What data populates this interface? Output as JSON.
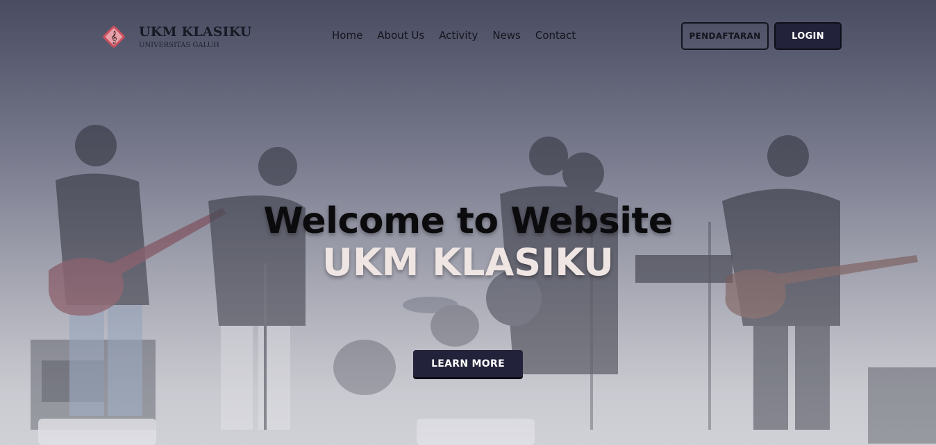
{
  "brand": {
    "title": "UKM KLASIKU",
    "subtitle": "UNIVERSITAS GALUH",
    "logo_icon": "music-clef-logo-icon"
  },
  "nav": {
    "items": [
      {
        "label": "Home"
      },
      {
        "label": "About Us"
      },
      {
        "label": "Activity"
      },
      {
        "label": "News"
      },
      {
        "label": "Contact"
      }
    ]
  },
  "actions": {
    "register_label": "PENDAFTARAN",
    "login_label": "LOGIN"
  },
  "hero": {
    "title": "Welcome to Website",
    "subtitle": "UKM KLASIKU",
    "cta_label": "LEARN MORE"
  },
  "colors": {
    "primary": "#22223a",
    "hero_subtitle": "#efe5e3",
    "text_dark": "#13141d"
  }
}
